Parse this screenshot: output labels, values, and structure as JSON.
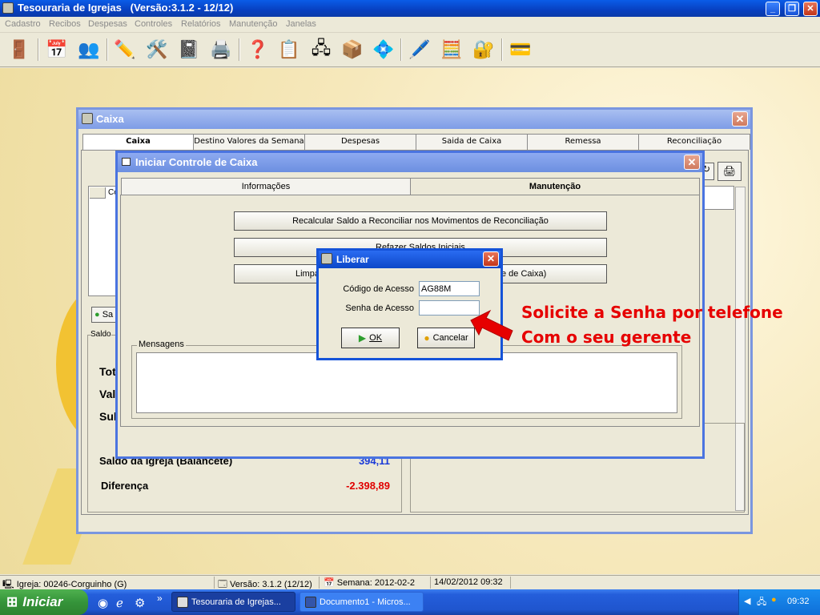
{
  "app": {
    "title": "Tesouraria de Igrejas   (Versão:3.1.2 - 12/12)",
    "controls": {
      "minimize": "_",
      "restore": "❐",
      "close": "✕"
    }
  },
  "menu": [
    "Cadastro",
    "Recibos",
    "Despesas",
    "Controles",
    "Relatórios",
    "Manutenção",
    "Janelas"
  ],
  "toolbar_icons": [
    "door-exit-icon",
    "calendar-icon",
    "users-icon",
    "edit-icon",
    "tools-icon",
    "notebook-icon",
    "printer-icon",
    "help-icon",
    "form-icon",
    "network-icon",
    "package-icon",
    "diamond-icon",
    "pen-icon",
    "calculator-icon",
    "safe-icon",
    "payment-icon"
  ],
  "caixa": {
    "title": "Caixa",
    "close": "✕",
    "tabs": [
      "Caixa",
      "Destino Valores da Semana",
      "Despesas",
      "Saida de Caixa",
      "Remessa",
      "Reconciliação"
    ],
    "behind": {
      "col": "Co",
      "sa_btn": "Sa",
      "saldo": "Saldo",
      "tot": "Tot",
      "val": "Val",
      "sub": "Sub",
      "saldo_igreja": "Saldo da Igreja (Balancete)",
      "saldo_igreja_val": "394,11",
      "diferenca": "Diferença",
      "diferenca_val": "-2.398,89"
    }
  },
  "iniciar": {
    "title": "Iniciar Controle de Caixa",
    "close": "✕",
    "tabs": [
      "Informações",
      "Manutenção"
    ],
    "buttons": {
      "recalcular": "Recalcular Saldo a Reconciliar nos Movimentos de Reconciliação",
      "refazer": "Refazer Saldos Iniciais",
      "limpar_left": "Limpa",
      "limpar_right": "e de Caixa)"
    },
    "mensagens": "Mensagens"
  },
  "liberar": {
    "title": "Liberar",
    "close": "✕",
    "codigo_label": "Código de Acesso",
    "codigo_value": "AG88M",
    "senha_label": "Senha de Acesso",
    "senha_value": "",
    "ok": "OK",
    "cancelar": "Cancelar"
  },
  "annotation": {
    "line1": "Solicite a Senha por telefone",
    "line2": "Com o seu gerente"
  },
  "status": {
    "igreja": "Igreja: 00246-Corguinho (G)",
    "versao": "Versão: 3.1.2 (12/12)",
    "semana": "Semana: 2012-02-2",
    "datahora": "14/02/2012  09:32"
  },
  "taskbar": {
    "start": "Iniciar",
    "tasks": [
      "Tesouraria de Igrejas...",
      "Documento1 - Micros..."
    ],
    "clock": "09:32",
    "chevron": "»"
  },
  "colors": {
    "annotation": "#e60000",
    "diferenca": "#e00000",
    "saldo_val": "#1a3ad8"
  }
}
